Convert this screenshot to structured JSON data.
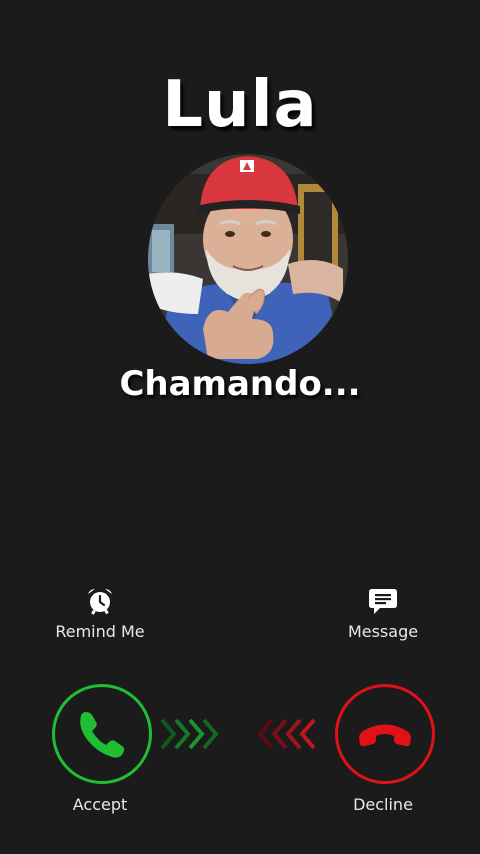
{
  "caller": {
    "name": "Lula",
    "status": "Chamando...",
    "avatar_icon": "caller-photo"
  },
  "actions": {
    "remind": {
      "label": "Remind Me",
      "icon": "alarm-clock-icon"
    },
    "message": {
      "label": "Message",
      "icon": "chat-bubble-icon"
    },
    "accept": {
      "label": "Accept",
      "icon": "phone-icon"
    },
    "decline": {
      "label": "Decline",
      "icon": "phone-hangup-icon"
    }
  },
  "colors": {
    "background": "#1b1b1b",
    "accept": "#1fbe33",
    "decline": "#e01218",
    "text": "#ffffff"
  }
}
